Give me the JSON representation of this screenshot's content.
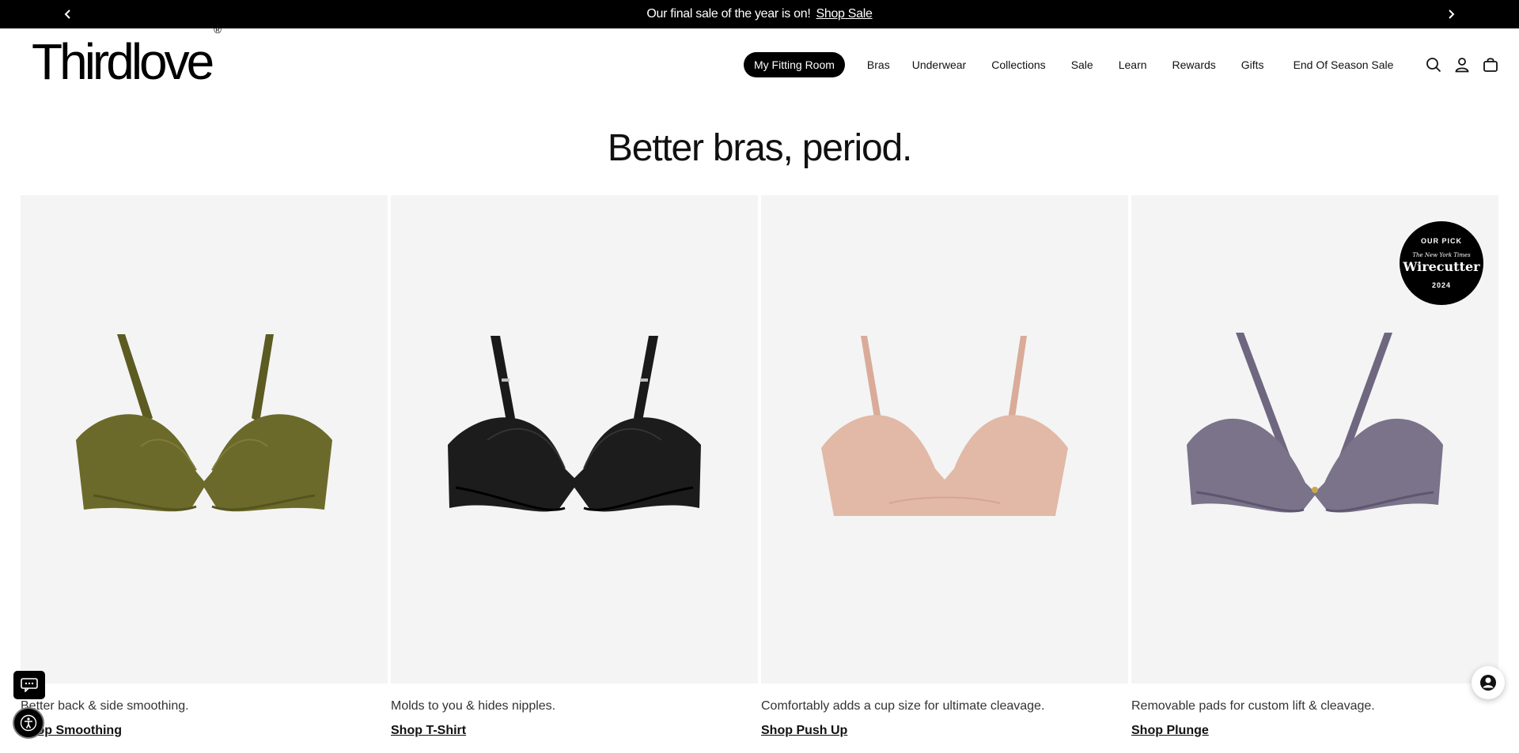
{
  "announcement": {
    "message": "Our final sale of the year is on!",
    "link_label": "Shop Sale",
    "prev_icon": "chevron-left-icon",
    "next_icon": "chevron-right-icon"
  },
  "header": {
    "logo": "Thirdlove",
    "logo_mark": "®",
    "nav": [
      {
        "label": "My Fitting Room"
      },
      {
        "label": "Bras"
      },
      {
        "label": "Underwear"
      },
      {
        "label": "Collections"
      },
      {
        "label": "Sale"
      },
      {
        "label": "Learn"
      },
      {
        "label": "Rewards"
      },
      {
        "label": "Gifts"
      },
      {
        "label": "End Of Season Sale"
      }
    ],
    "icons": [
      "search-icon",
      "account-icon",
      "cart-icon"
    ]
  },
  "headline": "Better bras, period.",
  "cards": [
    {
      "description": "Better back & side smoothing.",
      "cta": "Shop Smoothing",
      "color": "#6b6a2a"
    },
    {
      "description": "Molds to you & hides nipples.",
      "cta": "Shop T-Shirt",
      "color": "#1a1a1a"
    },
    {
      "description": "Comfortably adds a cup size for ultimate cleavage.",
      "cta": "Shop Push Up",
      "color": "#e2b9a6"
    },
    {
      "description": "Removable pads for custom lift & cleavage.",
      "cta": "Shop Plunge",
      "color": "#7b7389"
    }
  ],
  "badge": {
    "top": "OUR PICK",
    "publisher": "The New York Times",
    "name": "Wirecutter",
    "year": "2024"
  },
  "colors": {
    "announcement_bg": "#000000",
    "tile_bg": "#f4f4f4",
    "pill_bg": "#000000"
  }
}
